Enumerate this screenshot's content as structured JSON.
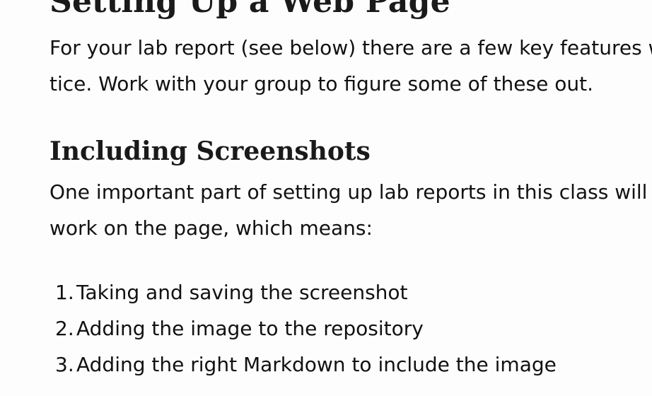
{
  "sections": {
    "setup": {
      "heading": "Setting Up a Web Page",
      "paragraph_lines": [
        "For your lab report (see below) there are a few key features we",
        "tice. Work with your group to figure some of these out."
      ]
    },
    "screenshots": {
      "heading": "Including Screenshots",
      "paragraph_lines": [
        "One important part of setting up lab reports in this class will b",
        "work on the page, which means:"
      ],
      "steps": [
        {
          "number": "1.",
          "text": "Taking and saving the screenshot"
        },
        {
          "number": "2.",
          "text": "Adding the image to the repository"
        },
        {
          "number": "3.",
          "text": "Adding the right Markdown to include the image"
        }
      ]
    }
  }
}
